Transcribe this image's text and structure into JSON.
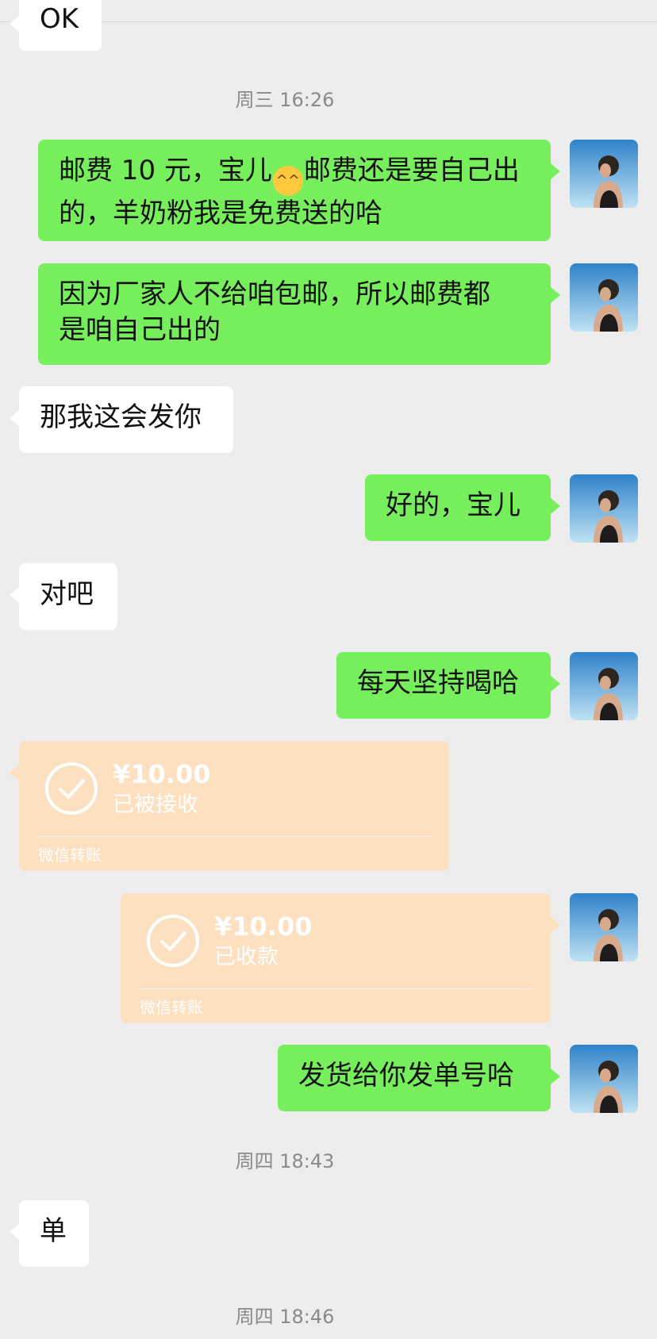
{
  "partial_top_message": "OK",
  "timestamps": {
    "t1": "周三 16:26",
    "t2": "周四 18:43",
    "t3": "周四 18:46"
  },
  "messages": {
    "m1_a": "邮费 10 元，宝儿",
    "m1_emoji": "^^",
    "m1_b": "邮费还是要自己出",
    "m1_c": "的，羊奶粉我是免费送的哈",
    "m2_a": "因为厂家人不给咱包邮，所以邮费都",
    "m2_b": "是咱自己出的",
    "m3": "那我这会发你",
    "m4": "好的，宝儿",
    "m5": "对吧",
    "m6": "每天坚持喝哈",
    "m7": "发货给你发单号哈",
    "m8": "单"
  },
  "transfers": {
    "received": {
      "amount": "¥10.00",
      "status": "已被接收",
      "label": "微信转账"
    },
    "collected": {
      "amount": "¥10.00",
      "status": "已收款",
      "label": "微信转账"
    }
  },
  "colors": {
    "background": "#ededed",
    "outgoing_bubble": "#77ef5d",
    "incoming_bubble": "#ffffff",
    "transfer_bubble": "#fde0bf"
  },
  "icons": {
    "transfer": "check-circle-icon",
    "avatar": "user-avatar-photo"
  }
}
